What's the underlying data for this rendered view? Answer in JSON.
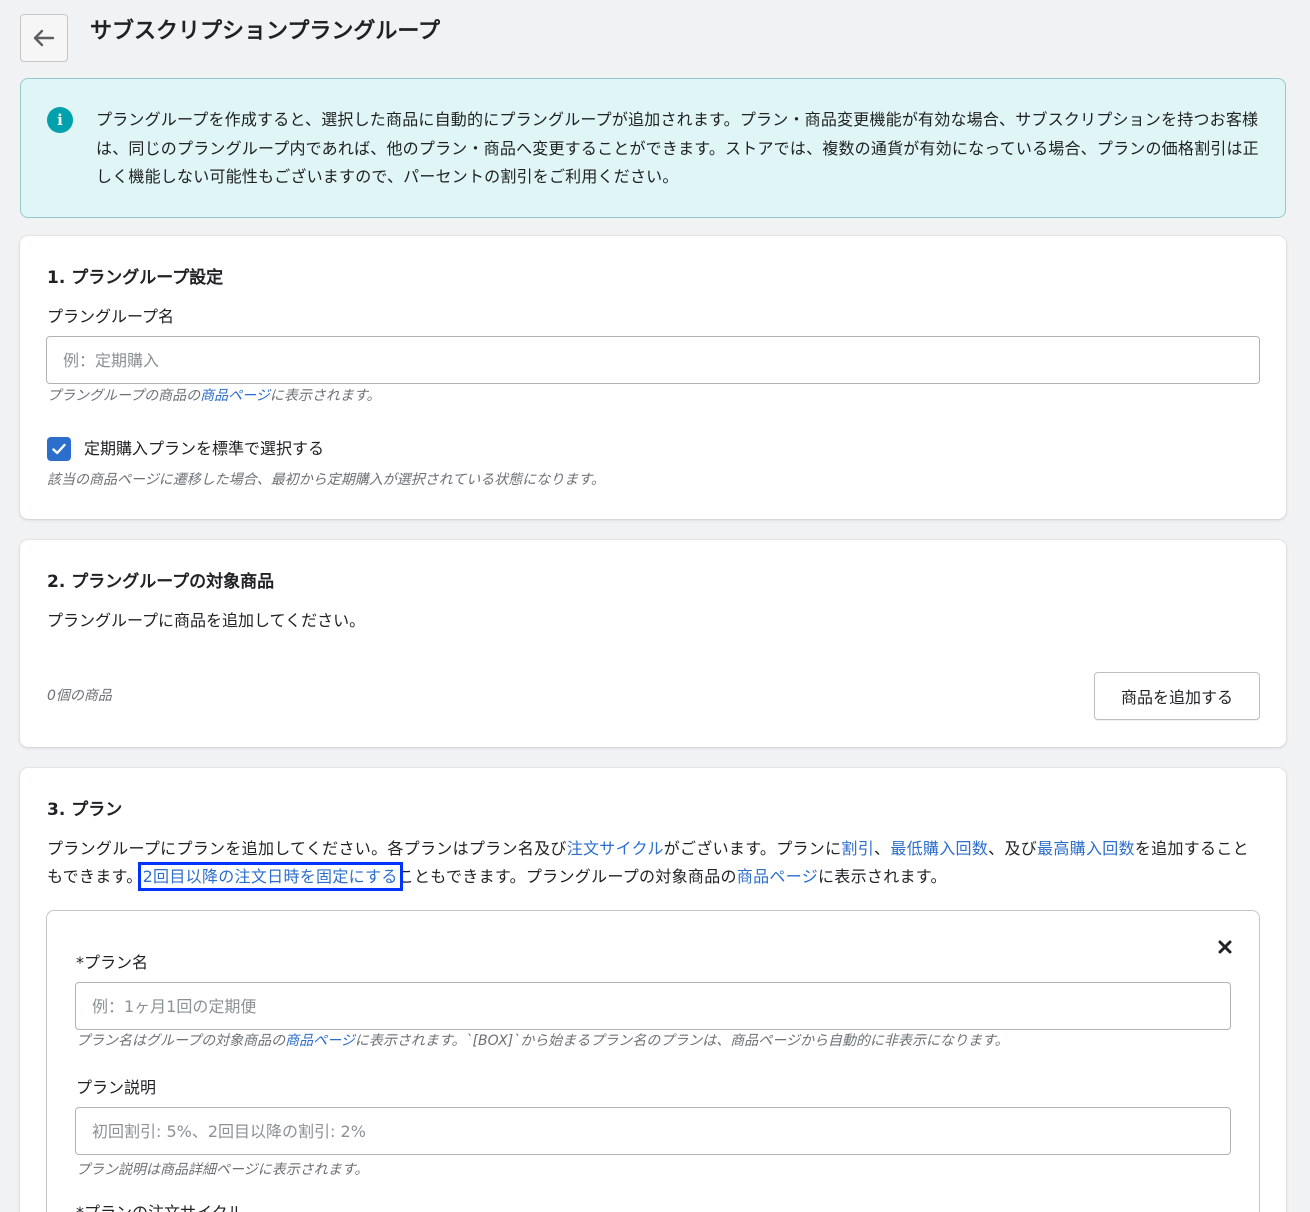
{
  "header": {
    "title": "サブスクリプションプラングループ"
  },
  "banner": {
    "text": "プラングループを作成すると、選択した商品に自動的にプラングループが追加されます。プラン・商品変更機能が有効な場合、サブスクリプションを持つお客様は、同じのプラングループ内であれば、他のプラン・商品へ変更することができます。ストアでは、複数の通貨が有効になっている場合、プランの価格割引は正しく機能しない可能性もございますので、パーセントの割引をご利用ください。"
  },
  "section1": {
    "title": "1. プラングループ設定",
    "group_name_label": "プラングループ名",
    "group_name_placeholder": "例：定期購入",
    "help_prefix": "プラングループの商品の",
    "help_link": "商品ページ",
    "help_suffix": "に表示されます。",
    "checkbox_label": "定期購入プランを標準で選択する",
    "checkbox_checked": true,
    "checkbox_help": "該当の商品ページに遷移した場合、最初から定期購入が選択されている状態になります。"
  },
  "section2": {
    "title": "2. プラングループの対象商品",
    "description": "プラングループに商品を追加してください。",
    "count_text": "0個の商品",
    "add_button": "商品を追加する"
  },
  "section3": {
    "title": "3. プラン",
    "desc_p1": "プラングループにプランを追加してください。各プランはプラン名及び",
    "desc_link1": "注文サイクル",
    "desc_p2": "がございます。プランに",
    "desc_link2": "割引",
    "desc_p3": "、",
    "desc_link3": "最低購入回数",
    "desc_p4": "、及び",
    "desc_link4": "最高購入回数",
    "desc_p5": "を追加することもできます。",
    "desc_link5": "2回目以降の注文日時を固定にする",
    "desc_p6": "こともできます。プラングループの対象商品の",
    "desc_link6": "商品ページ",
    "desc_p7": "に表示されます。",
    "plan": {
      "name_label": "*プラン名",
      "name_placeholder": "例：1ヶ月1回の定期便",
      "name_help_prefix": "プラン名はグループの対象商品の",
      "name_help_link": "商品ページ",
      "name_help_suffix": "に表示されます。`[BOX]`から始まるプラン名のプランは、商品ページから自動的に非表示になります。",
      "desc_label": "プラン説明",
      "desc_placeholder": "初回割引: 5%、2回目以降の割引: 2%",
      "desc_help": "プラン説明は商品詳細ページに表示されます。",
      "cycle_label": "*プランの注文サイクル"
    }
  },
  "colors": {
    "accent": "#2c6ecb",
    "banner_bg": "#e0f5f5",
    "info_icon": "#00a0ac",
    "highlight": "#0033ff"
  }
}
